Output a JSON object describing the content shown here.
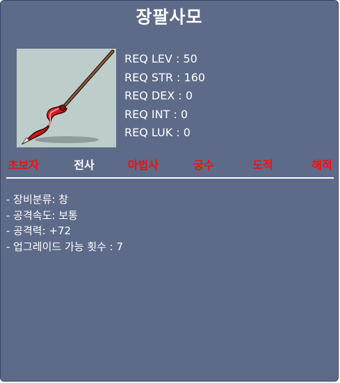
{
  "item": {
    "name": "장팔사모"
  },
  "requirements": [
    {
      "label": "REQ LEV",
      "value": "50"
    },
    {
      "label": "REQ STR",
      "value": "160"
    },
    {
      "label": "REQ DEX",
      "value": "0"
    },
    {
      "label": "REQ INT",
      "value": "0"
    },
    {
      "label": "REQ LUK",
      "value": "0"
    }
  ],
  "jobs": [
    {
      "name": "초보자",
      "allowed": false
    },
    {
      "name": "전사",
      "allowed": true
    },
    {
      "name": "마법사",
      "allowed": false
    },
    {
      "name": "궁수",
      "allowed": false
    },
    {
      "name": "도적",
      "allowed": false
    },
    {
      "name": "해적",
      "allowed": false
    }
  ],
  "stats": [
    "- 장비분류: 창",
    "- 공격속도: 보통",
    "- 공격력: +72",
    "- 업그레이드 가능 횟수 : 7"
  ],
  "colors": {
    "background": "#5d6b89",
    "icon_background": "#bccdca",
    "job_allowed": "#ffffff",
    "job_not_allowed": "#ee1111",
    "text": "#ffffff"
  },
  "icon": {
    "name": "red-spear-icon"
  }
}
